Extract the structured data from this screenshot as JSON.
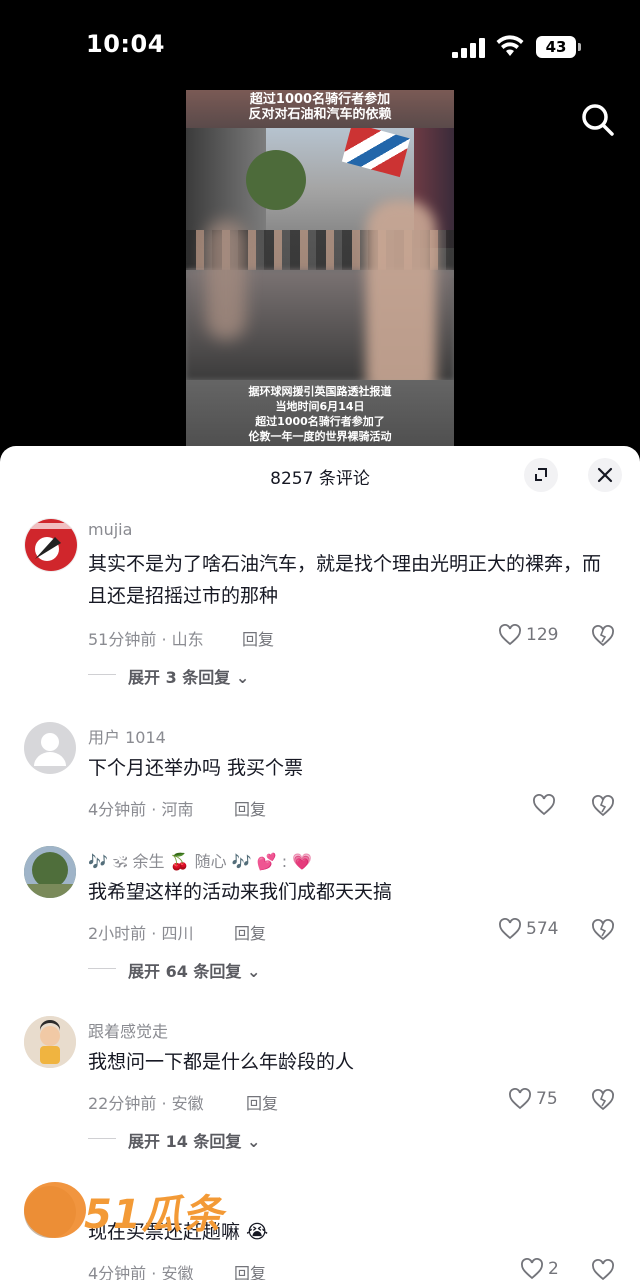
{
  "status_bar": {
    "time": "10:04",
    "battery": "43"
  },
  "video": {
    "caption_top_1": "超过1000名骑行者参加",
    "caption_top_2": "反对对石油和汽车的依赖",
    "caption_bottom": [
      "据环球网援引英国路透社报道",
      "当地时间6月14日",
      "超过1000名骑行者参加了",
      "伦敦一年一度的世界裸骑活动"
    ]
  },
  "sheet": {
    "title": "8257 条评论"
  },
  "comments": [
    {
      "user": "mujia",
      "text": "其实不是为了啥石油汽车，就是找个理由光明正大的裸奔，而且还是招摇过市的那种",
      "time_loc": "51分钟前 · 山东",
      "reply": "回复",
      "likes": "129",
      "expand": "展开 3 条回复"
    },
    {
      "user": "用户 1014",
      "text": "下个月还举办吗 我买个票",
      "time_loc": "4分钟前 · 河南",
      "reply": "回复",
      "likes": ""
    },
    {
      "user": "🎶 🕉 余生 🍒 随心 🎶 💕 : 💗",
      "text": "我希望这样的活动来我们成都天天搞",
      "time_loc": "2小时前 · 四川",
      "reply": "回复",
      "likes": "574",
      "expand": "展开 64 条回复"
    },
    {
      "user": "跟着感觉走",
      "text": "我想问一下都是什么年龄段的人",
      "time_loc": "22分钟前 · 安徽",
      "reply": "回复",
      "likes": "75",
      "expand": "展开 14 条回复"
    },
    {
      "user": "",
      "text": "现在买票还赶趟嘛 😭",
      "time_loc": "4分钟前 · 安徽",
      "reply": "回复",
      "likes": "2"
    }
  ],
  "watermark": {
    "text": "51瓜条"
  },
  "icons": {
    "search": "search-icon",
    "expand": "expand-icon",
    "close": "close-icon",
    "like": "heart-icon",
    "dislike": "broken-heart-icon"
  }
}
